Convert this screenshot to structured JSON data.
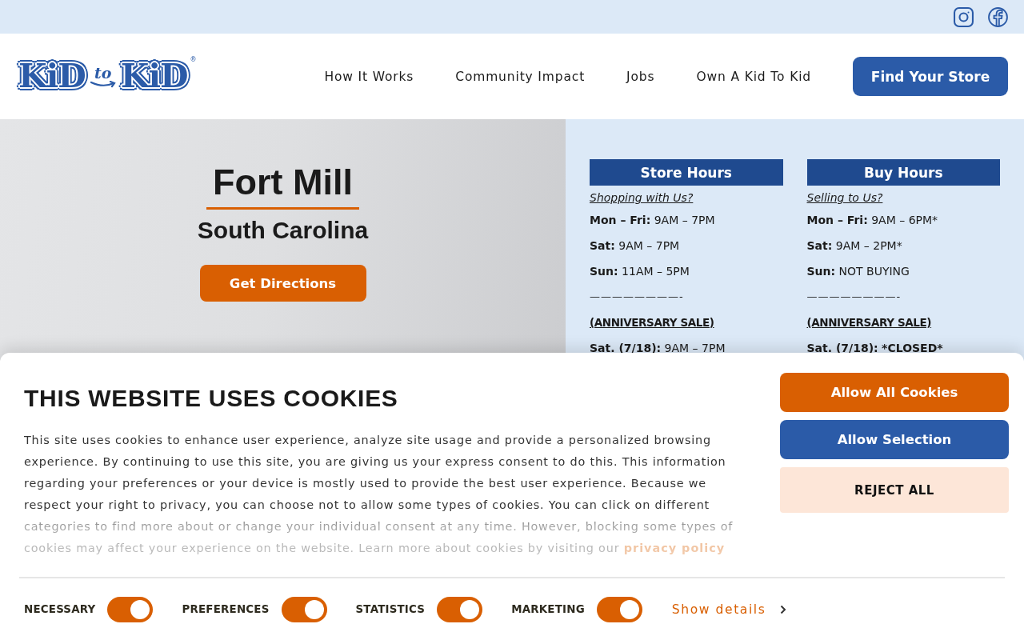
{
  "header": {
    "logo": {
      "words": [
        "KiD",
        "to",
        "KiD"
      ],
      "mark": "®"
    },
    "nav": [
      "How It Works",
      "Community Impact",
      "Jobs",
      "Own A Kid To Kid"
    ],
    "cta": "Find Your Store"
  },
  "store": {
    "city": "Fort Mill",
    "state": "South Carolina",
    "button": "Get Directions"
  },
  "hours": [
    {
      "title": "Store Hours",
      "subtitle": "Shopping with Us?",
      "rows": [
        {
          "kind": "hours",
          "label": "Mon – Fri:",
          "value": "9AM – 7PM",
          "value_bold": false
        },
        {
          "kind": "hours",
          "label": "Sat:",
          "value": "9AM – 7PM",
          "value_bold": false
        },
        {
          "kind": "hours",
          "label": "Sun:",
          "value": "11AM – 5PM",
          "value_bold": false
        },
        {
          "kind": "divider",
          "text": "————————-"
        },
        {
          "kind": "heading",
          "text": "(ANNIVERSARY SALE)"
        },
        {
          "kind": "hours",
          "label": "Sat. (7/18):",
          "value": "9AM – 7PM",
          "value_bold": false
        }
      ]
    },
    {
      "title": "Buy Hours",
      "subtitle": "Selling to Us?",
      "rows": [
        {
          "kind": "hours",
          "label": "Mon – Fri:",
          "value": "9AM – 6PM*",
          "value_bold": false
        },
        {
          "kind": "hours",
          "label": "Sat:",
          "value": "9AM – 2PM*",
          "value_bold": false
        },
        {
          "kind": "hours",
          "label": "Sun:",
          "value": "NOT BUYING",
          "value_bold": false
        },
        {
          "kind": "divider",
          "text": "————————-"
        },
        {
          "kind": "heading",
          "text": "(ANNIVERSARY SALE)"
        },
        {
          "kind": "hours",
          "label": "Sat. (7/18):",
          "value": "*CLOSED*",
          "value_bold": true
        }
      ]
    }
  ],
  "cookie_banner": {
    "title": "THIS WEBSITE USES COOKIES",
    "text": "This site uses cookies to enhance user experience, analyze site usage and provide a personalized browsing experience. By continuing to use this site, you are giving us your express consent to do this. This information regarding your preferences or your device is mostly used to provide the best user experience. Because we respect your right to privacy, you can choose not to allow some types of cookies. You can click on different categories to find more about or change your individual consent at any time. However, blocking some types of cookies may affect your experience on the website. Learn more about cookies by visiting our",
    "link": "privacy policy",
    "buttons": [
      {
        "label": "Allow All Cookies",
        "kind": "primary"
      },
      {
        "label": "Allow Selection",
        "kind": "secondary"
      },
      {
        "label": "REJECT ALL",
        "kind": "tertiary"
      }
    ],
    "categories": [
      {
        "label": "NECESSARY",
        "on": true
      },
      {
        "label": "PREFERENCES",
        "on": true
      },
      {
        "label": "STATISTICS",
        "on": true
      },
      {
        "label": "MARKETING",
        "on": true
      }
    ],
    "details_link": "Show details"
  }
}
